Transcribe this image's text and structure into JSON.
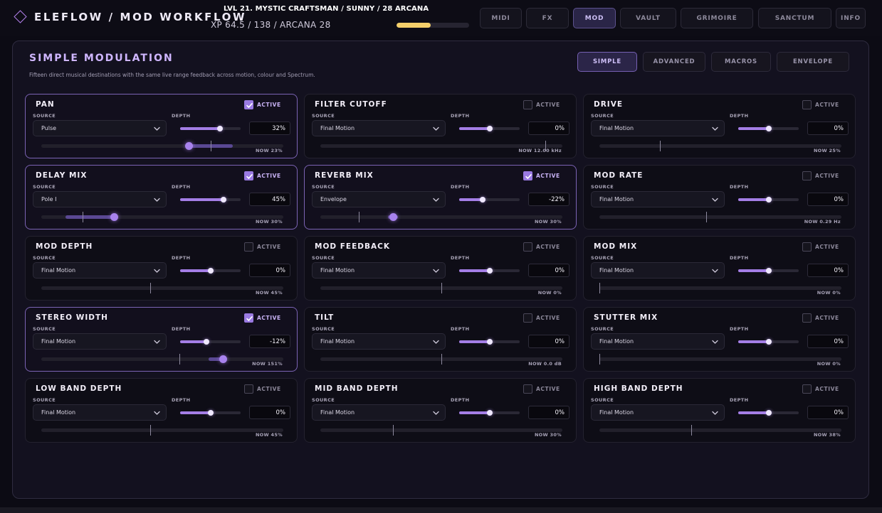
{
  "header": {
    "brand": "ELEFLOW  /  MOD WORKFLOW",
    "status_line1": "LVL 21. MYSTIC CRAFTSMAN  /  SUNNY  /  28 ARCANA",
    "status_line2": "XP 64.5 / 138   /   ARCANA 28",
    "xp_progress": 0.467,
    "nav_tabs": [
      {
        "label": "MIDI",
        "active": false
      },
      {
        "label": "FX",
        "active": false
      },
      {
        "label": "MOD",
        "active": true
      },
      {
        "label": "VAULT",
        "active": false
      },
      {
        "label": "GRIMOIRE",
        "active": false
      },
      {
        "label": "SANCTUM",
        "active": false
      },
      {
        "label": "INFO",
        "active": false
      }
    ]
  },
  "panel": {
    "title": "SIMPLE MODULATION",
    "subtitle": "Fifteen direct musical destinations with the same live range feedback across motion, colour and Spectrum.",
    "mode_tabs": [
      {
        "label": "SIMPLE",
        "active": true
      },
      {
        "label": "ADVANCED",
        "active": false
      },
      {
        "label": "MACROS",
        "active": false
      },
      {
        "label": "ENVELOPE",
        "active": false
      }
    ]
  },
  "labels": {
    "active": "ACTIVE",
    "source": "SOURCE",
    "depth": "DEPTH"
  },
  "cards": [
    {
      "title": "PAN",
      "active": true,
      "source": "Pulse",
      "depth": "32%",
      "depth_level": 0.66,
      "range_base": 0.7,
      "range_start": 0.61,
      "range_end": 0.79,
      "range_now": 0.61,
      "now": "NOW 23%"
    },
    {
      "title": "FILTER CUTOFF",
      "active": false,
      "source": "Final Motion",
      "depth": "0%",
      "depth_level": 0.5,
      "range_base": 0.93,
      "range_now": 0.93,
      "now": "NOW 12.00 kHz"
    },
    {
      "title": "DRIVE",
      "active": false,
      "source": "Final Motion",
      "depth": "0%",
      "depth_level": 0.5,
      "range_base": 0.25,
      "range_now": 0.25,
      "now": "NOW 25%"
    },
    {
      "title": "DELAY MIX",
      "active": true,
      "source": "Pole I",
      "depth": "45%",
      "depth_level": 0.72,
      "range_base": 0.17,
      "range_start": 0.1,
      "range_end": 0.3,
      "range_now": 0.3,
      "now": "NOW 30%"
    },
    {
      "title": "REVERB MIX",
      "active": true,
      "source": "Envelope",
      "depth": "-22%",
      "depth_level": 0.39,
      "range_base": 0.16,
      "range_start": 0.28,
      "range_end": 0.32,
      "range_now": 0.3,
      "now": "NOW 30%"
    },
    {
      "title": "MOD RATE",
      "active": false,
      "source": "Final Motion",
      "depth": "0%",
      "depth_level": 0.5,
      "range_base": 0.44,
      "range_now": 0.44,
      "now": "NOW 0.29 Hz"
    },
    {
      "title": "MOD DEPTH",
      "active": false,
      "source": "Final Motion",
      "depth": "0%",
      "depth_level": 0.5,
      "range_base": 0.45,
      "range_now": 0.45,
      "now": "NOW 45%"
    },
    {
      "title": "MOD FEEDBACK",
      "active": false,
      "source": "Final Motion",
      "depth": "0%",
      "depth_level": 0.5,
      "range_base": 0.5,
      "range_now": 0.5,
      "now": "NOW 0%"
    },
    {
      "title": "MOD MIX",
      "active": false,
      "source": "Final Motion",
      "depth": "0%",
      "depth_level": 0.5,
      "range_base": 0.0,
      "range_now": 0.0,
      "now": "NOW 0%"
    },
    {
      "title": "STEREO WIDTH",
      "active": true,
      "source": "Final Motion",
      "depth": "-12%",
      "depth_level": 0.44,
      "range_base": 0.57,
      "range_start": 0.69,
      "range_end": 0.75,
      "range_now": 0.75,
      "now": "NOW 151%"
    },
    {
      "title": "TILT",
      "active": false,
      "source": "Final Motion",
      "depth": "0%",
      "depth_level": 0.5,
      "range_base": 0.5,
      "range_now": 0.5,
      "now": "NOW 0.0 dB"
    },
    {
      "title": "STUTTER MIX",
      "active": false,
      "source": "Final Motion",
      "depth": "0%",
      "depth_level": 0.5,
      "range_base": 0.0,
      "range_now": 0.0,
      "now": "NOW 0%"
    },
    {
      "title": "LOW BAND DEPTH",
      "active": false,
      "source": "Final Motion",
      "depth": "0%",
      "depth_level": 0.5,
      "range_base": 0.45,
      "range_now": 0.45,
      "now": "NOW 45%"
    },
    {
      "title": "MID BAND DEPTH",
      "active": false,
      "source": "Final Motion",
      "depth": "0%",
      "depth_level": 0.5,
      "range_base": 0.3,
      "range_now": 0.3,
      "now": "NOW 30%"
    },
    {
      "title": "HIGH BAND DEPTH",
      "active": false,
      "source": "Final Motion",
      "depth": "0%",
      "depth_level": 0.5,
      "range_base": 0.38,
      "range_now": 0.38,
      "now": "NOW 38%"
    }
  ],
  "icons": {
    "logo": "diamond-icon",
    "check": "check-icon",
    "dropdown": "chevron-down-icon"
  },
  "colors": {
    "accent": "#a47ee6",
    "xp_bar": "#f4cf6a",
    "background": "#0c0b14"
  }
}
